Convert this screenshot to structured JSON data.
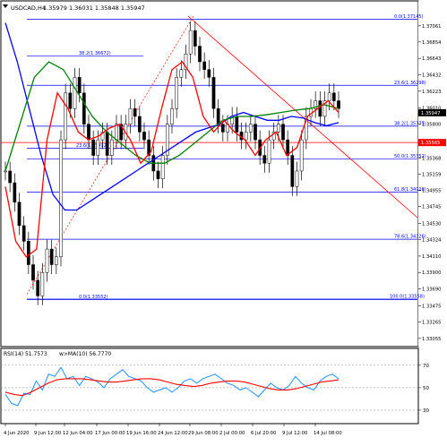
{
  "header": {
    "symbol_tf": "USDCAD,H4",
    "ohlc": "1.35979 1.36031 1.35848 1.35947"
  },
  "rsi_header": {
    "rsi_label": "RSI(14) 51.7573",
    "ma_label": "w>MA(10) 56.7770"
  },
  "colors": {
    "price_line": "#ff0000",
    "ma_blue": "#0000ff",
    "ma_green": "#008000",
    "ma_red": "#ff0000",
    "fib_line": "#0000ff",
    "trend_line": "#ff0000",
    "rsi_line": "#1e90ff",
    "rsi_ma": "#ff0000",
    "candle": "#000000"
  },
  "chart_data": [
    {
      "type": "line",
      "title": "",
      "x_ticks": [
        "4 Jun 2020",
        "9 Jun 12:00",
        "12 Jun 04:00",
        "17 Jun 00:00",
        "19 Jun 16:00",
        "24 Jun 12:00",
        "29 Jun 08:00",
        "2 Jul 00:00",
        "6 Jul 20:00",
        "9 Jul 12:00",
        "14 Jul 08:00"
      ],
      "y_ticks": [
        1.37061,
        1.36854,
        1.36643,
        1.36432,
        1.36223,
        1.3601,
        1.358,
        1.35577,
        1.35368,
        1.35159,
        1.34955,
        1.34745,
        1.3453,
        1.34324,
        1.3411,
        1.339,
        1.3369,
        1.33475,
        1.33265,
        1.33055
      ],
      "ylim": [
        1.3295,
        1.3738
      ],
      "current_price": 1.35947,
      "red_price_line": 1.35565,
      "fibonacci": [
        {
          "label": "0.0(1.37145)",
          "value": 1.37145
        },
        {
          "label": "38.2(1.36672)",
          "value": 1.36672
        },
        {
          "label": "23.6(1.36298)",
          "value": 1.36298
        },
        {
          "label": "38.2(1.35775)",
          "value": 1.35775
        },
        {
          "label": "23.6(1.35492)",
          "value": 1.35492
        },
        {
          "label": "50.0(1.35352)",
          "value": 1.35352
        },
        {
          "label": "61.8(1.34928)",
          "value": 1.34928
        },
        {
          "label": "78.6(1.34326)",
          "value": 1.34326
        },
        {
          "label": "0.0(1.33552)",
          "value": 1.33552
        },
        {
          "label": "100.0(1.33558)",
          "value": 1.33558
        }
      ],
      "candles": [
        1.352,
        1.3505,
        1.348,
        1.345,
        1.343,
        1.34,
        1.338,
        1.336,
        1.339,
        1.342,
        1.34,
        1.341,
        1.356,
        1.362,
        1.36,
        1.364,
        1.362,
        1.358,
        1.356,
        1.354,
        1.356,
        1.357,
        1.354,
        1.356,
        1.358,
        1.356,
        1.358,
        1.36,
        1.359,
        1.357,
        1.356,
        1.354,
        1.352,
        1.351,
        1.354,
        1.358,
        1.36,
        1.364,
        1.365,
        1.367,
        1.37,
        1.368,
        1.366,
        1.365,
        1.364,
        1.36,
        1.358,
        1.357,
        1.358,
        1.359,
        1.357,
        1.356,
        1.357,
        1.358,
        1.356,
        1.354,
        1.353,
        1.356,
        1.357,
        1.358,
        1.356,
        1.354,
        1.35,
        1.352,
        1.356,
        1.359,
        1.36,
        1.361,
        1.359,
        1.361,
        1.362,
        1.361,
        1.36
      ],
      "series": [
        {
          "name": "",
          "color": "#0000ff",
          "values": [
            1.371,
            1.366,
            1.36,
            1.354,
            1.349,
            1.347,
            1.347,
            1.348,
            1.349,
            1.35,
            1.351,
            1.352,
            1.353,
            1.354,
            1.355,
            1.356,
            1.357,
            1.3575,
            1.358,
            1.359,
            1.3595,
            1.359,
            1.3585,
            1.3585,
            1.359,
            1.3588,
            1.3582,
            1.3578,
            1.3582
          ]
        },
        {
          "name": "",
          "color": "#008000",
          "values": [
            1.352,
            1.358,
            1.364,
            1.366,
            1.365,
            1.362,
            1.359,
            1.357,
            1.3555,
            1.354,
            1.353,
            1.353,
            1.354,
            1.3555,
            1.357,
            1.3585,
            1.359,
            1.359,
            1.3592,
            1.3595,
            1.3598,
            1.36,
            1.3605,
            1.36
          ]
        },
        {
          "name": "",
          "color": "#ff0000",
          "values": [
            1.35,
            1.343,
            1.341,
            1.342,
            1.356,
            1.362,
            1.36,
            1.357,
            1.356,
            1.3565,
            1.3575,
            1.358,
            1.356,
            1.353,
            1.3545,
            1.36,
            1.365,
            1.366,
            1.364,
            1.359,
            1.357,
            1.3585,
            1.357,
            1.356,
            1.354,
            1.356,
            1.357,
            1.354,
            1.355,
            1.359,
            1.36,
            1.361,
            1.3595
          ]
        }
      ]
    },
    {
      "type": "line",
      "title": "",
      "y_ticks": [
        70,
        50,
        30
      ],
      "ylim": [
        18,
        85
      ],
      "series": [
        {
          "name": "RSI(14)",
          "color": "#1e90ff",
          "values": [
            44,
            36,
            34,
            45,
            44,
            56,
            48,
            62,
            60,
            68,
            58,
            60,
            52,
            60,
            58,
            55,
            50,
            58,
            62,
            66,
            60,
            58,
            56,
            50,
            46,
            48,
            50,
            46,
            50,
            56,
            58,
            54,
            58,
            60,
            62,
            58,
            54,
            52,
            48,
            50,
            46,
            42,
            48,
            54,
            50,
            48,
            52,
            60,
            54,
            50,
            48,
            56,
            60,
            62,
            58
          ]
        },
        {
          "name": "MA(10)",
          "color": "#ff0000",
          "values": [
            46,
            44,
            43,
            46,
            50,
            54,
            57,
            58,
            58,
            58,
            57,
            56,
            55,
            55,
            56,
            57,
            58,
            58,
            57,
            55,
            53,
            52,
            51,
            52,
            54,
            55,
            56,
            56,
            55,
            53,
            51,
            49,
            48,
            48,
            49,
            51,
            53,
            55,
            56,
            57
          ]
        }
      ]
    }
  ]
}
